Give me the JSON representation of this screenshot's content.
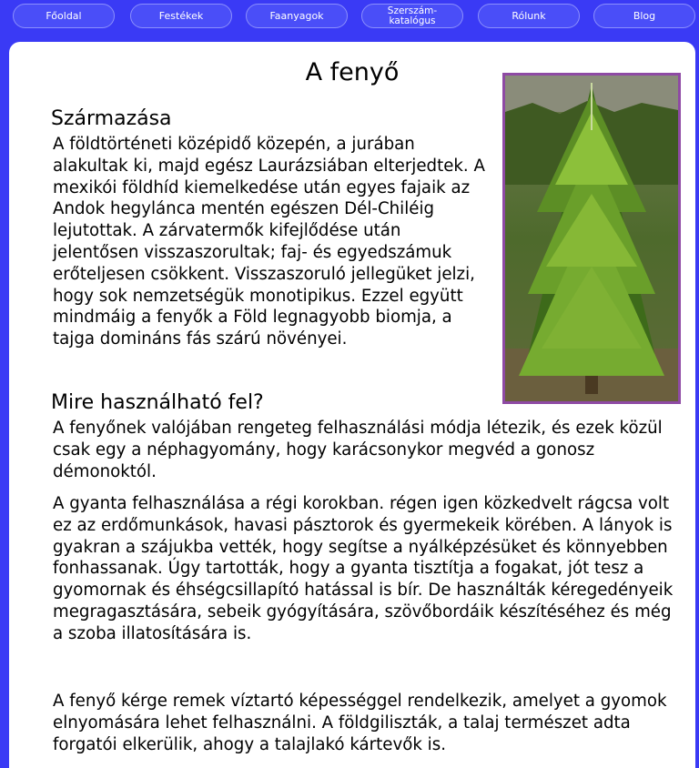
{
  "nav": {
    "items": [
      {
        "label": "Főoldal"
      },
      {
        "label": "Festékek"
      },
      {
        "label": "Faanyagok"
      },
      {
        "label": "Szerszám-\nkatalógus"
      },
      {
        "label": "Rólunk"
      },
      {
        "label": "Blog"
      }
    ]
  },
  "page": {
    "title": "A fenyő",
    "image_icon": "fir-tree-photo",
    "sections": [
      {
        "heading": "Származása",
        "paragraphs": [
          "A földtörténeti középidő közepén, a jurában alakultak ki, majd egész Laurázsiában elterjedtek. A mexikói földhíd kiemelkedése után egyes fajaik az Andok hegylánca mentén egészen Dél-Chiléig lejutottak. A zárvatermők kifejlődése után jelentősen visszaszorultak; faj- és egyedszámuk erőteljesen csökkent. Visszaszoruló jellegüket jelzi, hogy sok nemzetségük monotipikus. Ezzel együtt mindmáig a fenyők a Föld legnagyobb biomja, a tajga domináns fás szárú növényei."
        ]
      },
      {
        "heading": "Mire használható fel?",
        "paragraphs": [
          "A fenyőnek valójában rengeteg felhasználási módja létezik, és ezek közül csak egy a néphagyomány, hogy karácsonykor megvéd a gonosz démonoktól.",
          "A gyanta felhasználása a régi korokban. régen igen közkedvelt rágcsa volt ez az erdőmunkások, havasi pásztorok és gyermekeik körében. A lányok is gyakran a szájukba vették, hogy segítse a nyálképzésüket és könnyebben fonhassanak. Úgy tartották, hogy a gyanta tisztítja a fogakat, jót tesz a gyomornak és éhségcsillapító hatással is bír. De használták kéregedényeik megragasztására, sebeik gyógyítására, szövőbordáik készítéséhez és még a szoba illatosítására is.",
          "A fenyő kérge remek víztartó képességgel rendelkezik, amelyet a gyomok elnyomására lehet felhasználni. A földgiliszták, a talaj természet adta forgatói elkerülik, ahogy a talajlakó  kártevők is."
        ]
      }
    ]
  }
}
